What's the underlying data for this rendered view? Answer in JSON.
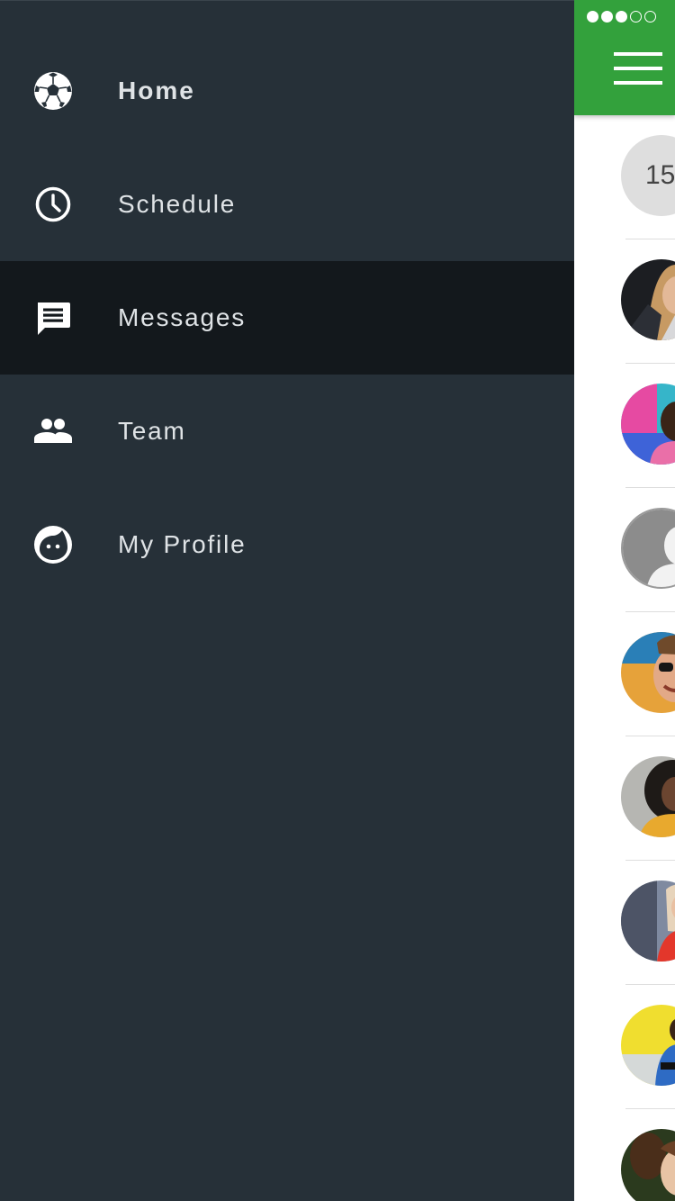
{
  "drawer": {
    "items": [
      {
        "label": "Home",
        "icon": "soccer-ball-icon",
        "bold": true,
        "active": false
      },
      {
        "label": "Schedule",
        "icon": "clock-icon",
        "bold": false,
        "active": false
      },
      {
        "label": "Messages",
        "icon": "message-icon",
        "bold": false,
        "active": true
      },
      {
        "label": "Team",
        "icon": "people-icon",
        "bold": false,
        "active": false
      },
      {
        "label": "My Profile",
        "icon": "face-icon",
        "bold": false,
        "active": false
      }
    ]
  },
  "status_bar": {
    "signal_total": 5,
    "signal_filled": 3
  },
  "main": {
    "menu_icon": "hamburger-menu-icon",
    "count_badge": "15",
    "avatars": [
      "avatar-woman-blonde",
      "avatar-man-colorful-background",
      "avatar-placeholder",
      "avatar-man-sunglasses",
      "avatar-woman-curly-hair",
      "avatar-woman-red-shirt",
      "avatar-man-blue-jacket",
      "avatar-woman-leaves"
    ]
  },
  "colors": {
    "drawer_bg": "#263038",
    "drawer_active_bg": "#13181c",
    "drawer_text": "#dfe3e6",
    "appbar_green": "#33a13c"
  }
}
